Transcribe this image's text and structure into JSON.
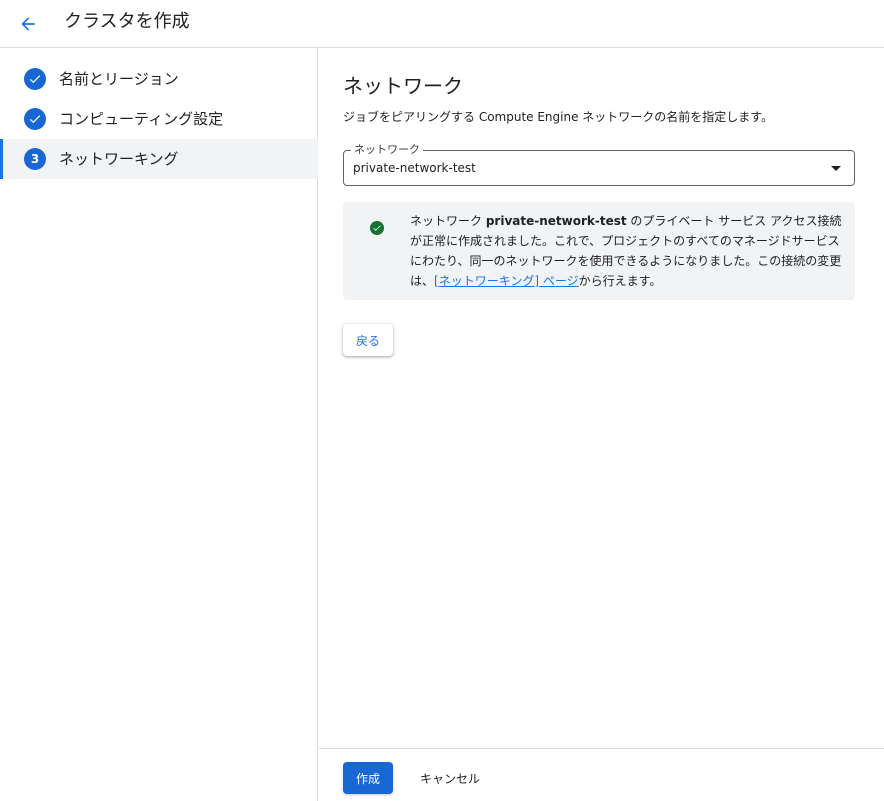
{
  "header": {
    "title": "クラスタを作成",
    "back_icon": "arrow-back-icon"
  },
  "colors": {
    "primary": "#1967d2",
    "link": "#1a73e8",
    "success": "#137333",
    "alert_bg": "#f1f3f4"
  },
  "sidebar": {
    "steps": [
      {
        "label": "名前とリージョン",
        "status": "complete",
        "icon": "check-circle-icon"
      },
      {
        "label": "コンピューティング設定",
        "status": "complete",
        "icon": "check-circle-icon"
      },
      {
        "label": "ネットワーキング",
        "status": "active",
        "number": "3"
      }
    ]
  },
  "main": {
    "title": "ネットワーク",
    "description": "ジョブをピアリングする Compute Engine ネットワークの名前を指定します。",
    "network_select": {
      "label": "ネットワーク",
      "value": "private-network-test"
    },
    "alert": {
      "icon": "check-circle-icon",
      "text_prefix": "ネットワーク ",
      "network_name": "private-network-test",
      "text_middle": " のプライベート サービス アクセス接続が正常に作成されました。これで、プロジェクトのすべてのマネージドサービスにわたり、同一のネットワークを使用できるようになりました。この接続の変更は、",
      "link_text": "[ネットワーキング] ページ",
      "text_suffix": "から行えます。"
    },
    "back_button_label": "戻る"
  },
  "footer": {
    "create_label": "作成",
    "cancel_label": "キャンセル"
  }
}
